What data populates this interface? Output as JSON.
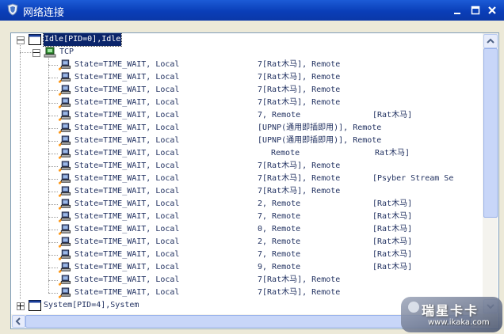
{
  "window": {
    "title": "网络连接"
  },
  "tree": {
    "root": {
      "label": "Idle[PID=0],Idle"
    },
    "protocol": {
      "label": "TCP"
    },
    "connections": [
      {
        "a": "State=TIME_WAIT, Local",
        "b": "7[Rat木马], Remote",
        "c": ""
      },
      {
        "a": "State=TIME_WAIT, Local",
        "b": "7[Rat木马], Remote",
        "c": ""
      },
      {
        "a": "State=TIME_WAIT, Local",
        "b": "7[Rat木马], Remote",
        "c": ""
      },
      {
        "a": "State=TIME_WAIT, Local",
        "b": "7[Rat木马], Remote",
        "c": ""
      },
      {
        "a": "State=TIME_WAIT, Local",
        "b": "7, Remote",
        "c": "[Rat木马]"
      },
      {
        "a": "State=TIME_WAIT, Local",
        "b": "[UPNP(通用即插即用)], Remote",
        "c": ""
      },
      {
        "a": "State=TIME_WAIT, Local",
        "b": "[UPNP(通用即插即用)], Remote",
        "c": ""
      },
      {
        "a": "State=TIME_WAIT, Local",
        "b": "Remote",
        "c": "Rat木马]"
      },
      {
        "a": "State=TIME_WAIT, Local",
        "b": "7[Rat木马], Remote",
        "c": ""
      },
      {
        "a": "State=TIME_WAIT, Local",
        "b": "7[Rat木马], Remote",
        "c": "[Psyber Stream Se"
      },
      {
        "a": "State=TIME_WAIT, Local",
        "b": "7[Rat木马], Remote",
        "c": ""
      },
      {
        "a": "State=TIME_WAIT, Local",
        "b": "2, Remote",
        "c": "[Rat木马]"
      },
      {
        "a": "State=TIME_WAIT, Local",
        "b": "7, Remote",
        "c": "[Rat木马]"
      },
      {
        "a": "State=TIME_WAIT, Local",
        "b": "0, Remote",
        "c": "[Rat木马]"
      },
      {
        "a": "State=TIME_WAIT, Local",
        "b": "2, Remote",
        "c": "[Rat木马]"
      },
      {
        "a": "State=TIME_WAIT, Local",
        "b": "7, Remote",
        "c": "[Rat木马]"
      },
      {
        "a": "State=TIME_WAIT, Local",
        "b": "9, Remote",
        "c": "[Rat木马]"
      },
      {
        "a": "State=TIME_WAIT, Local",
        "b": "7[Rat木马], Remote",
        "c": ""
      },
      {
        "a": "State=TIME_WAIT, Local",
        "b": "7[Rat木马], Remote",
        "c": ""
      }
    ],
    "next_process": {
      "label": "System[PID=4],System"
    }
  },
  "watermark": {
    "line1": "瑞星卡卡",
    "line2": "www.ikaka.com"
  },
  "colors": {
    "titlebar": "#0a3eb8",
    "selection": "#0a246a",
    "tree_text": "#1f2f5f"
  }
}
